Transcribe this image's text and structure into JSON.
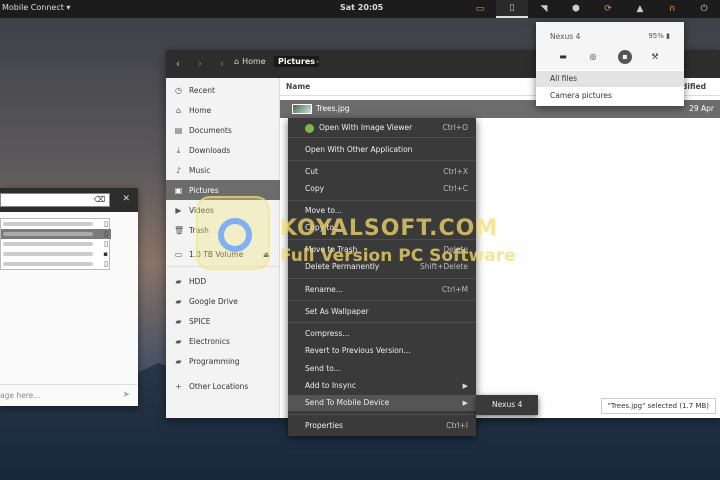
{
  "topbar": {
    "app_menu": "Mobile Connect ▾",
    "clock": "Sat 20:05"
  },
  "file_manager": {
    "breadcrumb": {
      "home": "Home",
      "current": "Pictures"
    },
    "sidebar": {
      "items": [
        {
          "label": "Recent",
          "icon": "clock-icon"
        },
        {
          "label": "Home",
          "icon": "home-icon"
        },
        {
          "label": "Documents",
          "icon": "document-icon"
        },
        {
          "label": "Downloads",
          "icon": "download-icon"
        },
        {
          "label": "Music",
          "icon": "music-icon"
        },
        {
          "label": "Pictures",
          "icon": "picture-icon"
        },
        {
          "label": "Videos",
          "icon": "video-icon"
        },
        {
          "label": "Trash",
          "icon": "trash-icon"
        },
        {
          "label": "1.0 TB Volume",
          "icon": "drive-icon"
        },
        {
          "label": "HDD",
          "icon": "folder-icon"
        },
        {
          "label": "Google Drive",
          "icon": "folder-icon"
        },
        {
          "label": "SPICE",
          "icon": "folder-icon"
        },
        {
          "label": "Electronics",
          "icon": "folder-icon"
        },
        {
          "label": "Programming",
          "icon": "folder-icon"
        },
        {
          "label": "Other Locations",
          "icon": "plus-icon"
        }
      ]
    },
    "columns": {
      "name": "Name",
      "modified": "dified"
    },
    "file": {
      "name": "Trees.jpg",
      "date": "29 Apr"
    },
    "status": "\"Trees.jpg\" selected  (1.7 MB)"
  },
  "context_menu": {
    "items": [
      {
        "label": "Open With Image Viewer",
        "shortcut": "Ctrl+O"
      },
      {
        "label": "Open With Other Application",
        "shortcut": ""
      },
      {
        "label": "Cut",
        "shortcut": "Ctrl+X"
      },
      {
        "label": "Copy",
        "shortcut": "Ctrl+C"
      },
      {
        "label": "Move to...",
        "shortcut": ""
      },
      {
        "label": "Copy to...",
        "shortcut": ""
      },
      {
        "label": "Move to Trash",
        "shortcut": "Delete"
      },
      {
        "label": "Delete Permanently",
        "shortcut": "Shift+Delete"
      },
      {
        "label": "Rename...",
        "shortcut": "Ctrl+M"
      },
      {
        "label": "Set As Wallpaper",
        "shortcut": ""
      },
      {
        "label": "Compress...",
        "shortcut": ""
      },
      {
        "label": "Revert to Previous Version...",
        "shortcut": ""
      },
      {
        "label": "Send to...",
        "shortcut": ""
      },
      {
        "label": "Add to Insync",
        "shortcut": ""
      },
      {
        "label": "Send To Mobile Device",
        "shortcut": ""
      },
      {
        "label": "Properties",
        "shortcut": "Ctrl+I"
      }
    ],
    "submenu_item": "Nexus 4"
  },
  "mobile_popup": {
    "device": "Nexus 4",
    "battery": "95%",
    "items": [
      "All files",
      "Camera pictures"
    ]
  },
  "dialog": {
    "placeholder": "age here..."
  },
  "watermark": {
    "line1": "KOYALSOFT.COM",
    "line2": "Full Version PC Software"
  },
  "colors": {
    "topbar": "#1c1c1c",
    "header": "#2d2d2d",
    "selection": "#6c6c6c",
    "menu": "#3a3a3a"
  }
}
